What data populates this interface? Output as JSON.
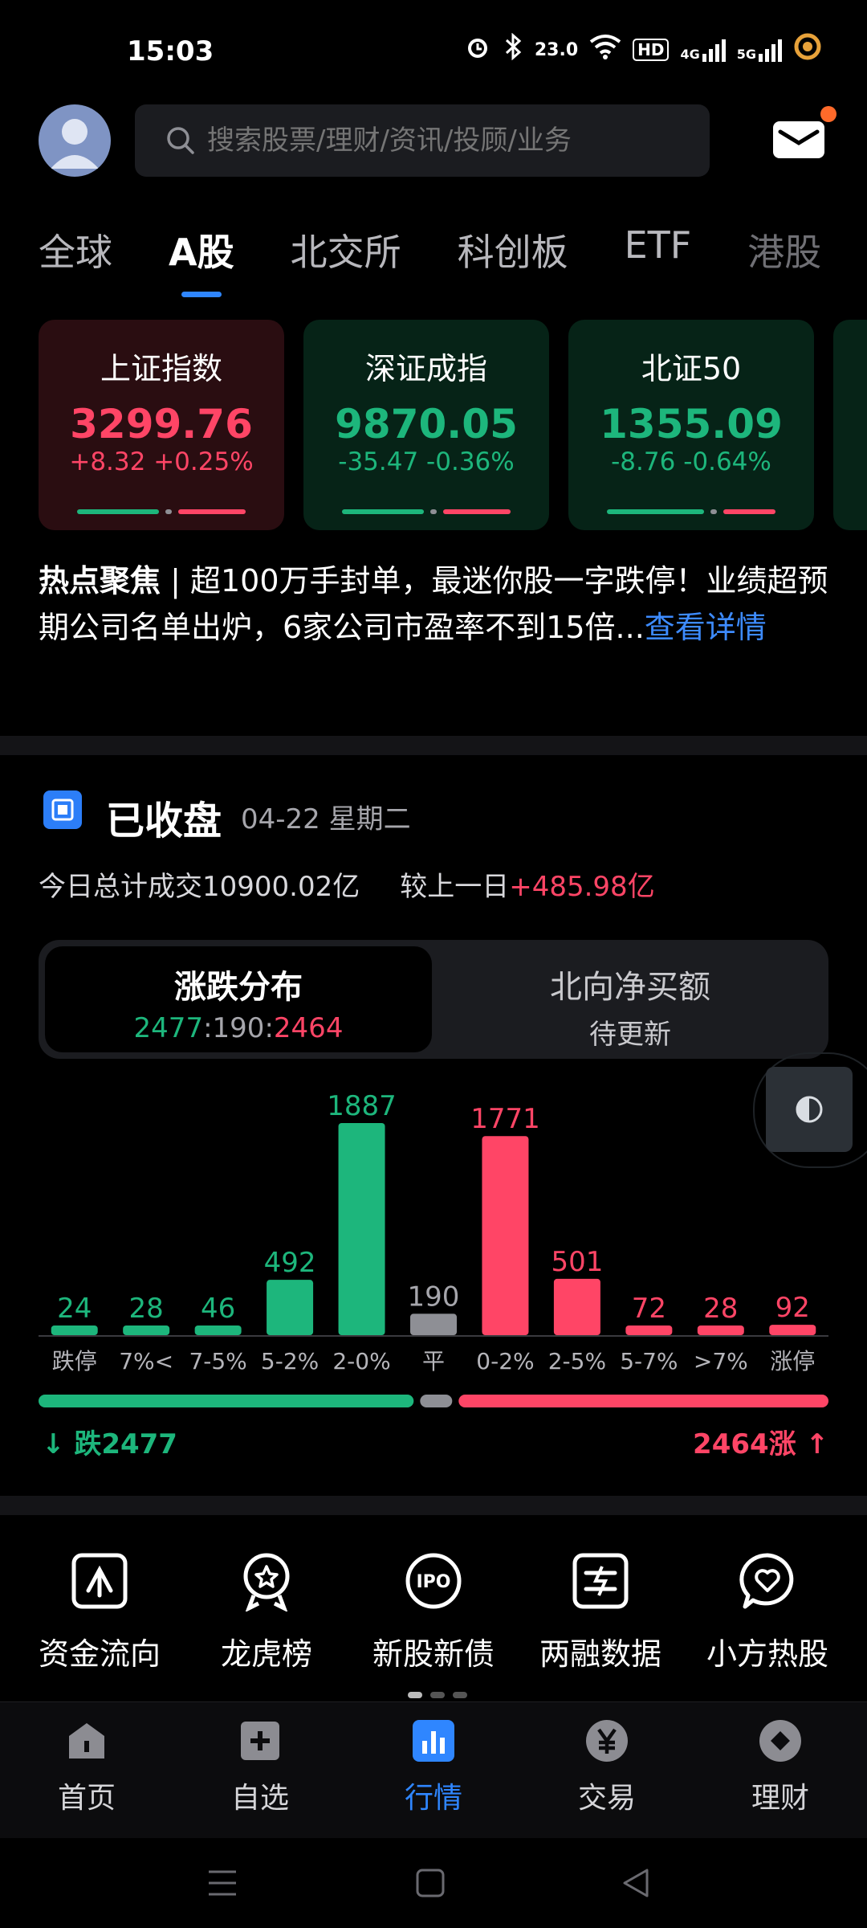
{
  "status": {
    "time": "15:03",
    "network_speed": "23.0",
    "net_labels": [
      "HD",
      "4G",
      "5G"
    ]
  },
  "search": {
    "placeholder": "搜索股票/理财/资讯/投顾/业务"
  },
  "tabs": [
    {
      "label": "全球",
      "active": false
    },
    {
      "label": "A股",
      "active": true
    },
    {
      "label": "北交所",
      "active": false
    },
    {
      "label": "科创板",
      "active": false
    },
    {
      "label": "ETF",
      "active": false
    },
    {
      "label": "港股",
      "active": false
    }
  ],
  "indices": [
    {
      "name": "上证指数",
      "value": "3299.76",
      "change": "+8.32 +0.25%",
      "trend": "up",
      "up_share": 0.45
    },
    {
      "name": "深证成指",
      "value": "9870.05",
      "change": "-35.47 -0.36%",
      "trend": "down",
      "up_share": 0.45
    },
    {
      "name": "北证50",
      "value": "1355.09",
      "change": "-8.76 -0.64%",
      "trend": "down",
      "up_share": 0.35
    }
  ],
  "news": {
    "keyword": "热点聚焦",
    "separator": " | ",
    "text": "超100万手封单，最迷你股一字跌停！业绩超预期公司名单出炉，6家公司市盈率不到15倍...",
    "link": "查看详情"
  },
  "market": {
    "title": "已收盘",
    "date": "04-22 星期二",
    "turnover_label": "今日总计成交",
    "turnover_value": "10900.02亿",
    "compare_label": "较上一日",
    "compare_value": "+485.98亿"
  },
  "segment": {
    "left_title": "涨跌分布",
    "down": "2477",
    "sep1": ":",
    "flat": "190",
    "sep2": ":",
    "up": "2464",
    "right_title": "北向净买额",
    "right_sub": "待更新"
  },
  "chart_data": {
    "type": "bar",
    "categories": [
      "跌停",
      "7%<",
      "7-5%",
      "5-2%",
      "2-0%",
      "平",
      "0-2%",
      "2-5%",
      "5-7%",
      ">7%",
      "涨停"
    ],
    "values": [
      24,
      28,
      46,
      492,
      1887,
      190,
      1771,
      501,
      72,
      28,
      92
    ],
    "bar_groups": [
      "down",
      "down",
      "down",
      "down",
      "down",
      "flat",
      "up",
      "up",
      "up",
      "up",
      "up"
    ],
    "colors": {
      "down": "#1db67c",
      "flat": "#8e8f95",
      "up": "#ff4566"
    },
    "ylim": [
      0,
      1887
    ]
  },
  "breadth": {
    "down_label": "跌2477",
    "up_label": "2464涨",
    "down_count": 2477,
    "flat_count": 190,
    "up_count": 2464
  },
  "shortcuts": [
    {
      "label": "资金流向",
      "icon": "fund-flow-icon"
    },
    {
      "label": "龙虎榜",
      "icon": "dragon-tiger-icon"
    },
    {
      "label": "新股新债",
      "icon": "ipo-icon"
    },
    {
      "label": "两融数据",
      "icon": "margin-data-icon"
    },
    {
      "label": "小方热股",
      "icon": "hot-stock-icon"
    }
  ],
  "nav": [
    {
      "label": "首页",
      "icon": "home-icon",
      "active": false
    },
    {
      "label": "自选",
      "icon": "watchlist-icon",
      "active": false
    },
    {
      "label": "行情",
      "icon": "market-icon",
      "active": true
    },
    {
      "label": "交易",
      "icon": "trade-icon",
      "active": false
    },
    {
      "label": "理财",
      "icon": "wealth-icon",
      "active": false
    }
  ],
  "ipo_icon_text": "IPO"
}
